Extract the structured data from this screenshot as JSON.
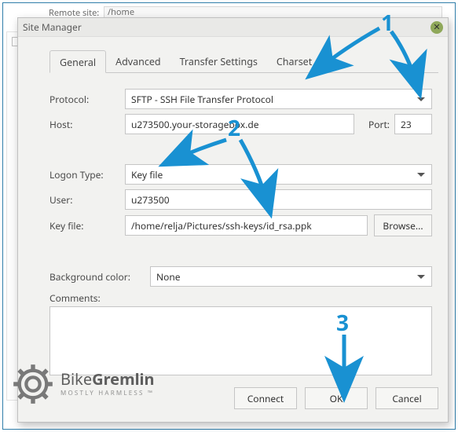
{
  "background": {
    "remoteSiteLabel": "Remote site:",
    "remoteSitePath": "/home"
  },
  "dialog": {
    "title": "Site Manager"
  },
  "tabs": [
    "General",
    "Advanced",
    "Transfer Settings",
    "Charset"
  ],
  "activeTab": 0,
  "fields": {
    "protocolLabel": "Protocol:",
    "protocolValue": "SFTP - SSH File Transfer Protocol",
    "hostLabel": "Host:",
    "hostValue": "u273500.your-storagebox.de",
    "portLabel": "Port:",
    "portValue": "23",
    "logonLabel": "Logon Type:",
    "logonValue": "Key file",
    "userLabel": "User:",
    "userValue": "u273500",
    "keyfileLabel": "Key file:",
    "keyfileValue": "/home/relja/Pictures/ssh-keys/id_rsa.ppk",
    "browseLabel": "Browse...",
    "bgcolorLabel": "Background color:",
    "bgcolorValue": "None",
    "commentsLabel": "Comments:",
    "commentsValue": ""
  },
  "buttons": {
    "connect": "Connect",
    "ok": "OK",
    "cancel": "Cancel"
  },
  "watermark": {
    "brand1": "Bike",
    "brand2": "Gremlin",
    "tagline": "MOSTLY HARMLESS ™"
  },
  "annotations": {
    "n1": "1",
    "n2": "2",
    "n3": "3"
  }
}
